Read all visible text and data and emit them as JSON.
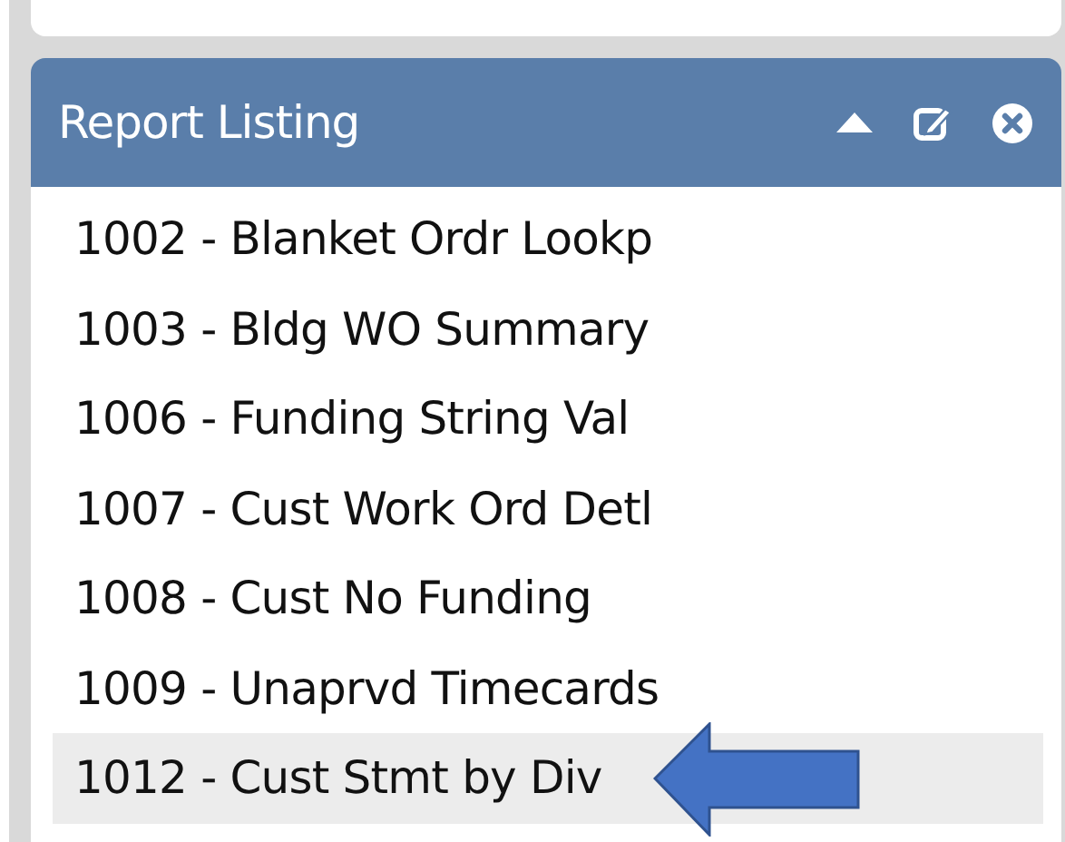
{
  "panel": {
    "title": "Report Listing",
    "expanded": true
  },
  "reports": [
    {
      "label": "1002 - Blanket Ordr Lookp",
      "selected": false
    },
    {
      "label": "1003 - Bldg WO Summary",
      "selected": false
    },
    {
      "label": "1006 - Funding String Val",
      "selected": false
    },
    {
      "label": "1007 - Cust Work Ord Detl",
      "selected": false
    },
    {
      "label": "1008 - Cust No Funding",
      "selected": false
    },
    {
      "label": "1009 - Unaprvd Timecards",
      "selected": false
    },
    {
      "label": "1012 - Cust Stmt by Div",
      "selected": true
    }
  ]
}
